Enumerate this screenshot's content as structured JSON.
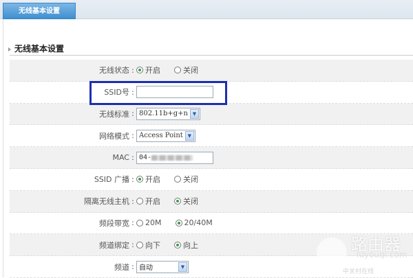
{
  "tab": {
    "label": "无线基本设置"
  },
  "section": {
    "title": "无线基本设置"
  },
  "form": {
    "wireless_status": {
      "label": "无线状态",
      "on": "开启",
      "off": "关闭",
      "selected": "on"
    },
    "ssid": {
      "label": "SSID号",
      "value": ""
    },
    "standard": {
      "label": "无线标准",
      "value": "802.11b+g+n"
    },
    "mode": {
      "label": "网络模式",
      "value": "Access Point"
    },
    "mac": {
      "label": "MAC",
      "value": "04-"
    },
    "ssid_broadcast": {
      "label": "SSID 广播",
      "on": "开启",
      "off": "关闭",
      "selected": "on"
    },
    "isolation": {
      "label": "隔离无线主机",
      "on": "开启",
      "off": "关闭",
      "selected": "off"
    },
    "bandwidth": {
      "label": "频段带宽",
      "opt1": "20M",
      "opt2": "20/40M",
      "selected": "opt2"
    },
    "channel_bind": {
      "label": "频道绑定",
      "opt1": "向下",
      "opt2": "向上",
      "selected": "opt2"
    },
    "channel": {
      "label": "频道",
      "value": "自动"
    }
  },
  "colon": ":",
  "dropdown_glyph": "▼",
  "watermark": {
    "title": "路由器",
    "domain": "luyouqi.com",
    "brand": "中关村在线",
    "logo": "ZOL"
  },
  "colors": {
    "highlight": "#1b2fb0",
    "tab": "#3f8fd0"
  }
}
